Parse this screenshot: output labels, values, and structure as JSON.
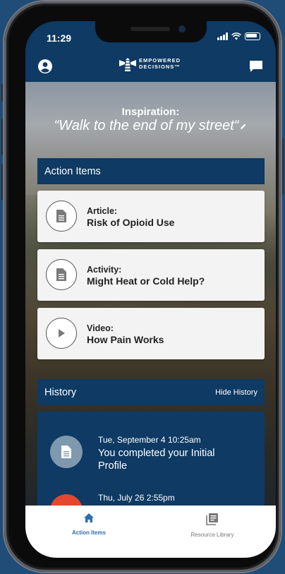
{
  "status_bar": {
    "time": "11:29"
  },
  "header": {
    "logo_line1": "EMPOWERED",
    "logo_line2": "DECISIONS™"
  },
  "inspiration": {
    "label": "Inspiration:",
    "quote": "“Walk to the end of my street“"
  },
  "action_items": {
    "title": "Action Items",
    "items": [
      {
        "type": "Article:",
        "title": "Risk of Opioid Use",
        "icon": "document-icon"
      },
      {
        "type": "Activity:",
        "title": "Might Heat or Cold Help?",
        "icon": "document-icon"
      },
      {
        "type": "Video:",
        "title": "How Pain Works",
        "icon": "play-icon"
      }
    ]
  },
  "history": {
    "title": "History",
    "toggle_label": "Hide History",
    "entries": [
      {
        "date": "Tue, September 4 10:25am",
        "description": "You completed your Initial Profile",
        "icon": "document-icon",
        "color": "#7e98ae"
      },
      {
        "date": "Thu, July 26 2:55pm",
        "description": "",
        "icon": "heart-icon",
        "color": "#e4472f"
      }
    ]
  },
  "tabs": [
    {
      "label": "Action Items",
      "icon": "home-icon",
      "active": true
    },
    {
      "label": "Resource Library",
      "icon": "library-icon",
      "active": false
    }
  ],
  "colors": {
    "brand_navy": "#0e3a63",
    "accent_blue": "#2f6fb0",
    "page_background": "#1f4d78"
  }
}
